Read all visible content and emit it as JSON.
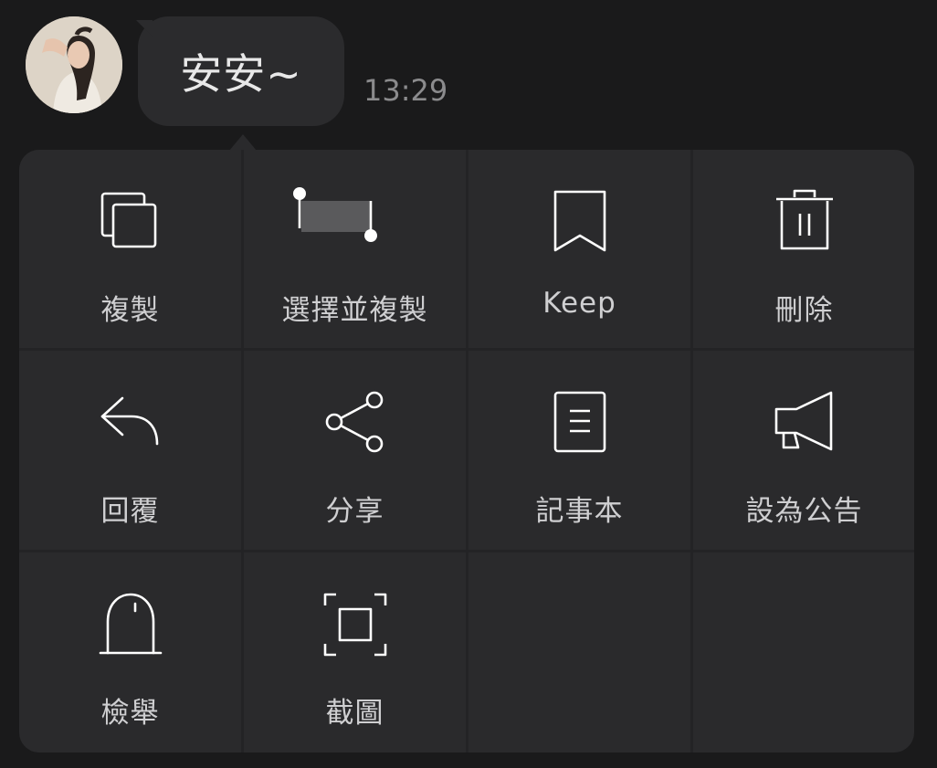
{
  "message": {
    "text": "安安~",
    "time": "13:29"
  },
  "menu": {
    "items": [
      {
        "label": "複製",
        "icon": "copy-icon"
      },
      {
        "label": "選擇並複製",
        "icon": "select-text-icon"
      },
      {
        "label": "Keep",
        "icon": "bookmark-icon"
      },
      {
        "label": "刪除",
        "icon": "trash-icon"
      },
      {
        "label": "回覆",
        "icon": "reply-icon"
      },
      {
        "label": "分享",
        "icon": "share-icon"
      },
      {
        "label": "記事本",
        "icon": "note-icon"
      },
      {
        "label": "設為公告",
        "icon": "megaphone-icon"
      },
      {
        "label": "檢舉",
        "icon": "report-icon"
      },
      {
        "label": "截圖",
        "icon": "screenshot-icon"
      }
    ]
  },
  "colors": {
    "background": "#1a1a1b",
    "bubble": "#2b2b2d",
    "menu_cell": "#2a2a2c",
    "icon_stroke": "#ffffff",
    "label_text": "#cfcfd1",
    "timestamp": "#8b8b8d"
  }
}
